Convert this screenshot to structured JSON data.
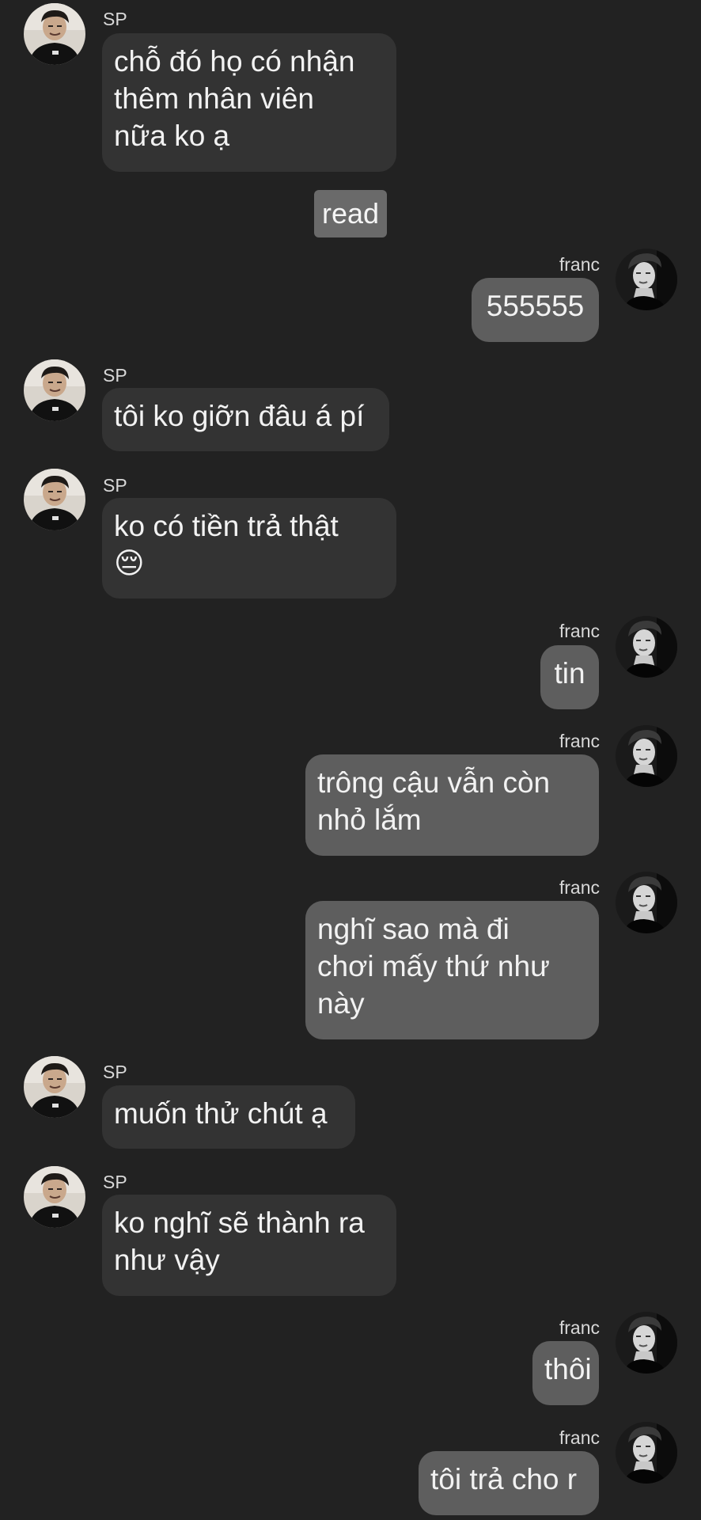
{
  "participants": {
    "sp": {
      "name": "SP",
      "avatar_icon": "person-photo-avatar-sp"
    },
    "franc": {
      "name": "franc",
      "avatar_icon": "person-photo-avatar-franc"
    }
  },
  "read_receipt": "read",
  "messages": [
    {
      "sender": "SP",
      "text": "chỗ đó họ có nhận\nthêm nhân viên\nnữa ko ạ"
    },
    {
      "sender": "franc",
      "text": "555555"
    },
    {
      "sender": "SP",
      "text": "tôi ko giỡn đâu á pí"
    },
    {
      "sender": "SP",
      "text": "ko có tiền trả thật\n😔"
    },
    {
      "sender": "franc",
      "text": "tin"
    },
    {
      "sender": "franc",
      "text": "trông cậu vẫn còn\nnhỏ lắm"
    },
    {
      "sender": "franc",
      "text": "nghĩ sao mà đi\nchơi mấy thứ như\nnày"
    },
    {
      "sender": "SP",
      "text": "muốn thử chút ạ"
    },
    {
      "sender": "SP",
      "text": "ko nghĩ sẽ thành ra\nnhư vậy"
    },
    {
      "sender": "franc",
      "text": "thôi"
    },
    {
      "sender": "franc",
      "text": "tôi trả cho r"
    }
  ],
  "colors": {
    "background": "#222222",
    "incoming_bubble": "#333333",
    "outgoing_bubble": "#5e5e5e",
    "read_badge": "#6a6a6a"
  }
}
